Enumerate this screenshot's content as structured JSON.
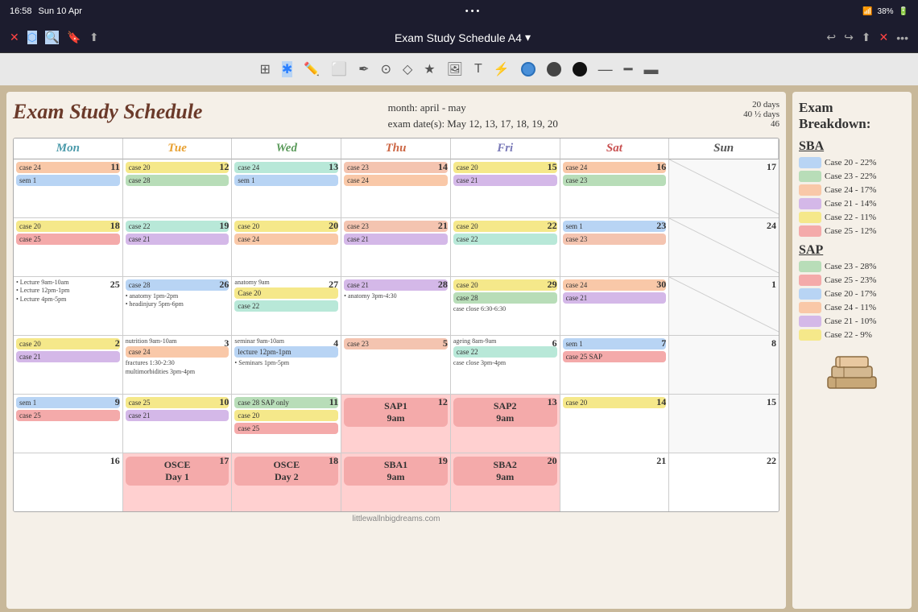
{
  "statusBar": {
    "time": "16:58",
    "date": "Sun 10 Apr",
    "wifi": "WiFi",
    "battery": "38%"
  },
  "toolbar": {
    "title": "Exam Study Schedule A4",
    "dropdownIcon": "▾"
  },
  "schedule": {
    "title": "Exam Study Schedule",
    "monthLabel": "month: april - may",
    "examDates": "exam date(s): May 12, 13, 17, 18, 19, 20",
    "stats": {
      "fullDays": "20 days",
      "halfDays": "40 ½ days",
      "number": "46"
    }
  },
  "calHeaders": [
    "Mon",
    "Tue",
    "Wed",
    "Thu",
    "Fri",
    "Sat",
    "Sun"
  ],
  "sidebar": {
    "title": "Exam Breakdown:",
    "sections": [
      {
        "name": "SBA",
        "items": [
          {
            "label": "Case 20 - 22%",
            "color": "#b8d4f4"
          },
          {
            "label": "Case 23 - 22%",
            "color": "#b8ddb8"
          },
          {
            "label": "Case 24 - 17%",
            "color": "#f9c8a8"
          },
          {
            "label": "Case 21 - 14%",
            "color": "#d4b8e8"
          },
          {
            "label": "Case 22 - 11%",
            "color": "#f5e88a"
          },
          {
            "label": "Case 25 - 12%",
            "color": "#f4aaaa"
          }
        ]
      },
      {
        "name": "SAP",
        "items": [
          {
            "label": "Case 23 - 28%",
            "color": "#b8ddb8"
          },
          {
            "label": "Case 25 - 23%",
            "color": "#f4aaaa"
          },
          {
            "label": "Case 20 - 17%",
            "color": "#b8d4f4"
          },
          {
            "label": "Case 24 - 11%",
            "color": "#f9c8a8"
          },
          {
            "label": "Case 21 - 10%",
            "color": "#d4b8e8"
          },
          {
            "label": "Case 22 - 9%",
            "color": "#f5e88a"
          }
        ]
      }
    ]
  },
  "watermark": "littlewallnbigdreams.com"
}
